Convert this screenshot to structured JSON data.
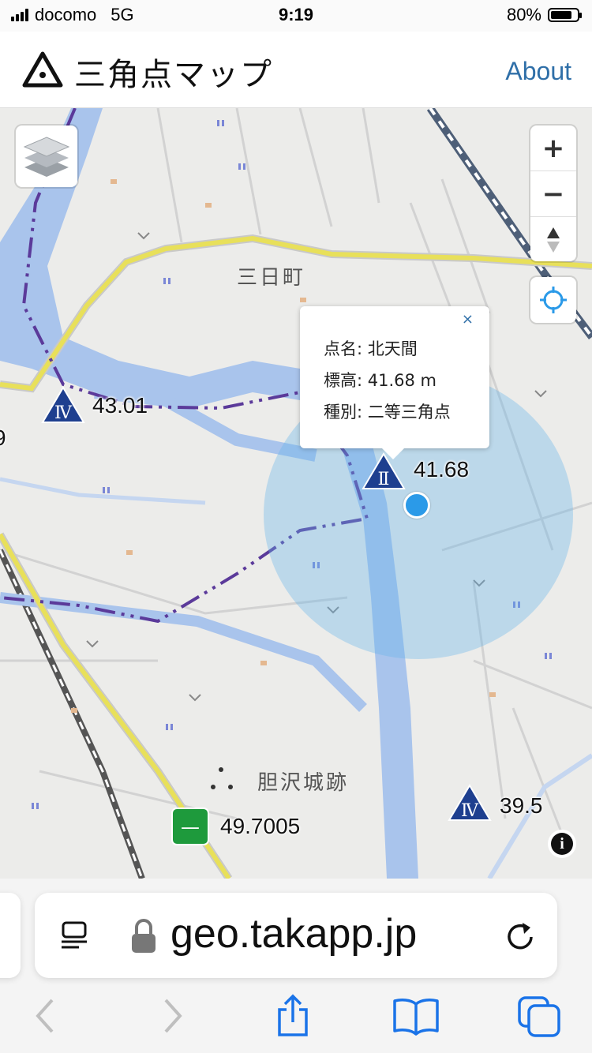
{
  "status_bar": {
    "carrier": "docomo",
    "network": "5G",
    "time": "9:19",
    "battery": "80%",
    "battery_level": 0.8
  },
  "header": {
    "app_title": "三角点マップ",
    "about_label": "About"
  },
  "map": {
    "place_labels": [
      "三日町",
      "胆沢城跡"
    ],
    "markers": [
      {
        "icon": "triangle-point-grade4-icon",
        "grade_glyph": "Ⅳ",
        "elevation": "43.01"
      },
      {
        "icon": "triangle-point-grade2-icon",
        "grade_glyph": "Ⅱ",
        "elevation": "41.68"
      },
      {
        "icon": "triangle-point-grade4-icon",
        "grade_glyph": "Ⅳ",
        "elevation": "39.5"
      },
      {
        "icon": "triangle-point-grade1-icon",
        "grade_glyph": "—",
        "elevation": "49.7005"
      }
    ],
    "edge_label": "9",
    "popup": {
      "close": "×",
      "name_row": "点名: 北天間",
      "elevation_row": "標高: 41.68 m",
      "type_row": "種別: 二等三角点"
    },
    "controls": {
      "zoom_in": "+",
      "zoom_out": "−"
    },
    "colors": {
      "marker_blue": "#1e3f8f",
      "marker_green": "#1e9a3c",
      "river": "#a9c4ec",
      "road_yellow": "#e8e05a",
      "boundary_purple": "#5b3a9a",
      "location_blue": "#2b9ae8"
    }
  },
  "browser": {
    "url": "geo.takapp.jp",
    "icons": [
      "page-menu-icon",
      "lock-icon",
      "reload-icon",
      "back-icon",
      "forward-icon",
      "share-icon",
      "bookmarks-icon",
      "tabs-icon"
    ]
  }
}
